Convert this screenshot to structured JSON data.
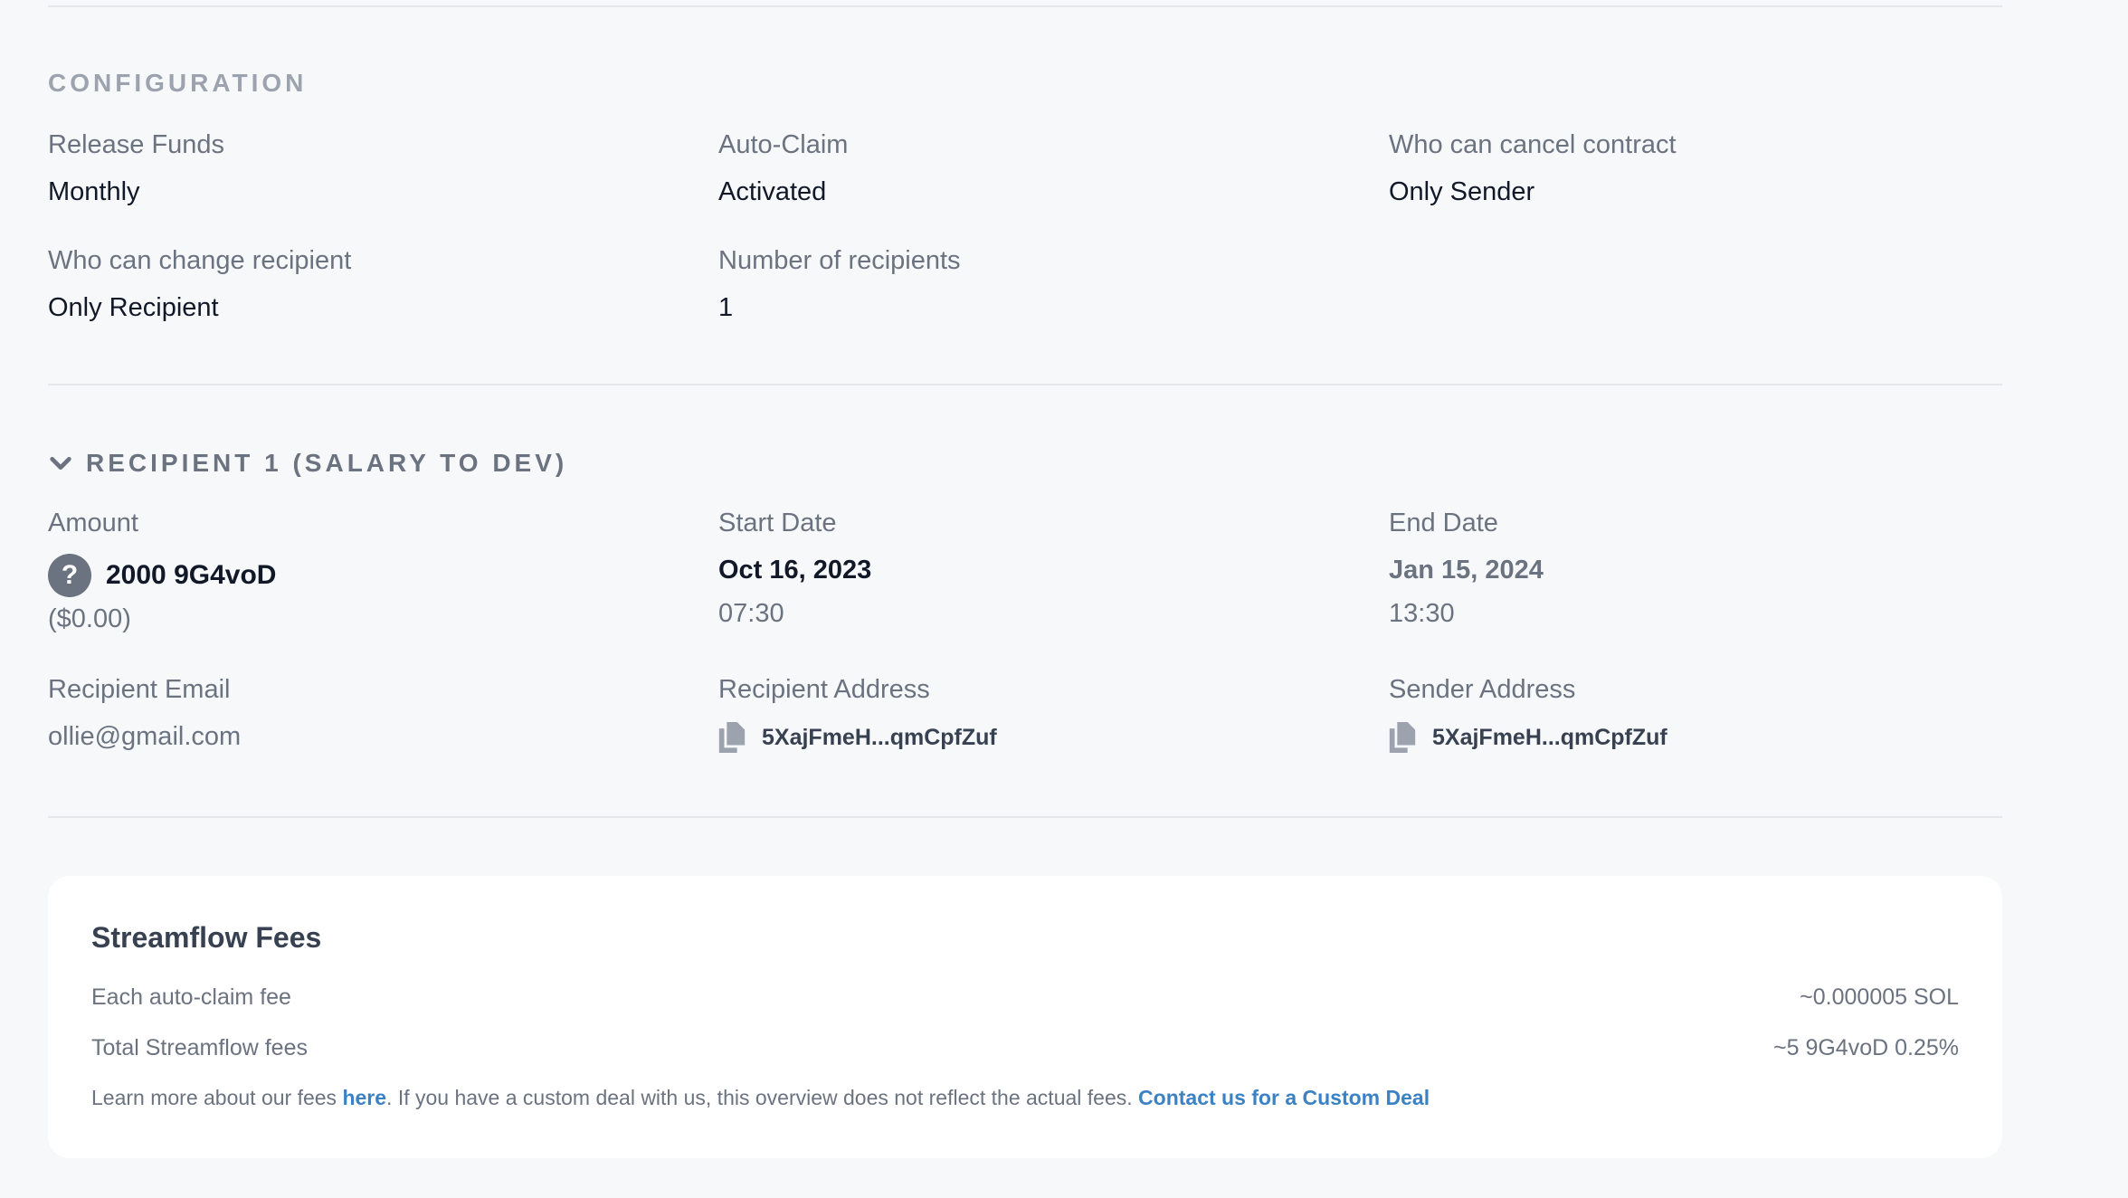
{
  "configuration": {
    "title": "CONFIGURATION",
    "fields": [
      {
        "label": "Release Funds",
        "value": "Monthly"
      },
      {
        "label": "Auto-Claim",
        "value": "Activated"
      },
      {
        "label": "Who can cancel contract",
        "value": "Only Sender"
      },
      {
        "label": "Who can change recipient",
        "value": "Only Recipient"
      },
      {
        "label": "Number of recipients",
        "value": "1"
      }
    ]
  },
  "recipient": {
    "title": "RECIPIENT 1 (SALARY TO DEV)",
    "amount": {
      "label": "Amount",
      "value": "2000 9G4voD",
      "usd": "($0.00)",
      "token_icon": "question-mark-icon"
    },
    "start": {
      "label": "Start Date",
      "date": "Oct 16, 2023",
      "time": "07:30"
    },
    "end": {
      "label": "End Date",
      "date": "Jan 15, 2024",
      "time": "13:30"
    },
    "email": {
      "label": "Recipient Email",
      "value": "ollie@gmail.com"
    },
    "recipient_address": {
      "label": "Recipient Address",
      "value": "5XajFmeH...qmCpfZuf"
    },
    "sender_address": {
      "label": "Sender Address",
      "value": "5XajFmeH...qmCpfZuf"
    }
  },
  "fees": {
    "title": "Streamflow Fees",
    "rows": [
      {
        "label": "Each auto-claim fee",
        "value": "~0.000005 SOL"
      },
      {
        "label": "Total Streamflow fees",
        "value": "~5 9G4voD 0.25%"
      }
    ],
    "note_prefix": "Learn more about our fees ",
    "note_link": "here",
    "note_middle": ". If you have a custom deal with us, this overview does not reflect the actual fees. ",
    "contact_link": "Contact us for a Custom Deal"
  },
  "colors": {
    "background": "#f7f8fa",
    "link": "#3b82c4",
    "muted": "#6b7280"
  }
}
